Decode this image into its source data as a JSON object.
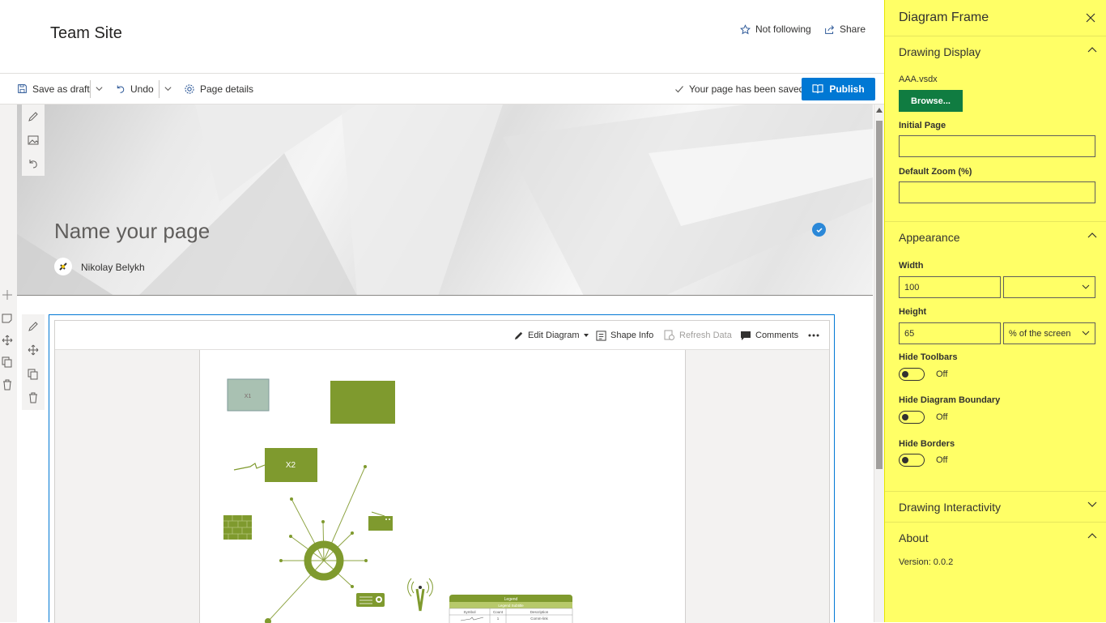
{
  "header": {
    "site_title": "Team Site",
    "follow_label": "Not following",
    "share_label": "Share"
  },
  "commandbar": {
    "save_draft_label": "Save as draft",
    "undo_label": "Undo",
    "page_details_label": "Page details",
    "saved_status": "Your page has been saved",
    "publish_label": "Publish"
  },
  "hero": {
    "page_title": "Name your page",
    "author": "Nikolay Belykh"
  },
  "webpart_toolbar": {
    "edit_diagram_label": "Edit Diagram",
    "shape_info_label": "Shape Info",
    "refresh_label": "Refresh Data",
    "comments_label": "Comments"
  },
  "diagram": {
    "shape_x1_label": "X1",
    "shape_x2_label": "X2",
    "legend_title": "Legend",
    "legend_subtitle": "Legend Subtitle",
    "legend_columns": [
      "Symbol",
      "Count",
      "Description"
    ],
    "legend_row": [
      "",
      "1",
      "Comm-link"
    ],
    "accent_color": "#7f9a2e"
  },
  "pane": {
    "title": "Diagram Frame",
    "drawing_display": {
      "header": "Drawing Display",
      "file_name": "AAA.vsdx",
      "browse_label": "Browse...",
      "initial_page_label": "Initial Page",
      "initial_page_value": "",
      "default_zoom_label": "Default Zoom (%)",
      "default_zoom_value": ""
    },
    "appearance": {
      "header": "Appearance",
      "width_label": "Width",
      "width_value": "100",
      "width_unit": "",
      "height_label": "Height",
      "height_value": "65",
      "height_unit": "% of the screen",
      "hide_toolbars_label": "Hide Toolbars",
      "hide_toolbars_state": "Off",
      "hide_boundary_label": "Hide Diagram Boundary",
      "hide_boundary_state": "Off",
      "hide_borders_label": "Hide Borders",
      "hide_borders_state": "Off"
    },
    "interactivity": {
      "header": "Drawing Interactivity"
    },
    "about": {
      "header": "About",
      "version": "Version: 0.0.2"
    },
    "background_color": "#ffff66",
    "browse_color": "#107c41"
  },
  "publish_color": "#0078d4"
}
